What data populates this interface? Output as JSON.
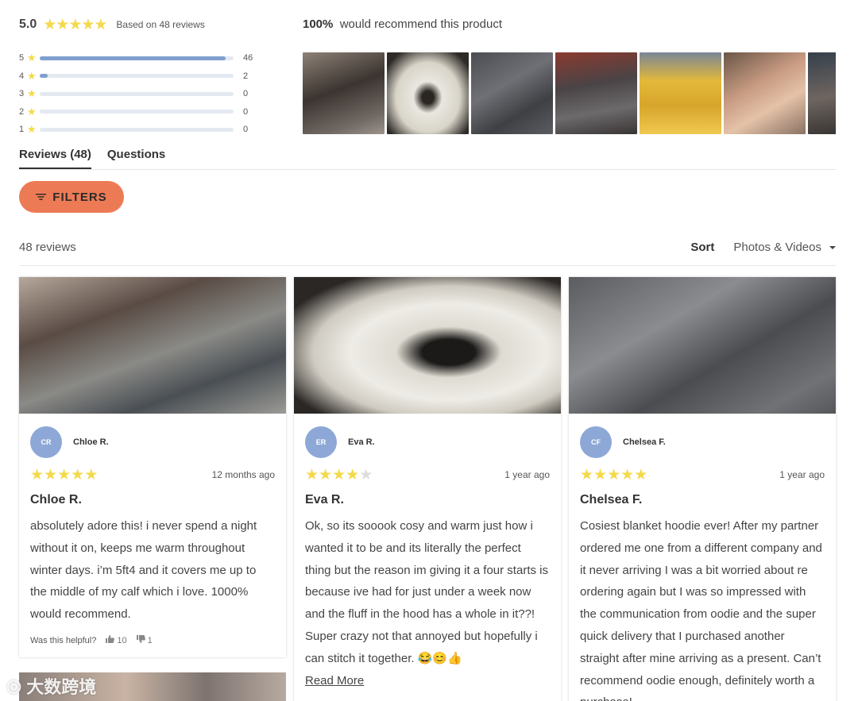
{
  "summary": {
    "average": "5.0",
    "based_on": "Based on 48 reviews",
    "histogram": [
      {
        "stars": "5",
        "count": "46",
        "fraction": 0.958
      },
      {
        "stars": "4",
        "count": "2",
        "fraction": 0.042
      },
      {
        "stars": "3",
        "count": "0",
        "fraction": 0
      },
      {
        "stars": "2",
        "count": "0",
        "fraction": 0
      },
      {
        "stars": "1",
        "count": "0",
        "fraction": 0
      }
    ]
  },
  "recommend": {
    "percent": "100%",
    "text": "would recommend this product"
  },
  "tabs": [
    {
      "label": "Reviews (48)"
    },
    {
      "label": "Questions"
    }
  ],
  "filters_label": "FILTERS",
  "reviews_count": "48 reviews",
  "sort": {
    "label": "Sort",
    "selected": "Photos & Videos"
  },
  "colors": {
    "accent": "#ec7b55",
    "star": "#f4d94a",
    "avatar": "#8da8d6",
    "bar": "#7f9fce"
  },
  "reviews": [
    {
      "initials": "CR",
      "name": "Chloe R.",
      "rating": 5,
      "when": "12 months ago",
      "title": "Chloe R.",
      "text": "absolutely adore this! i never spend a night without it on, keeps me warm throughout winter days. i’m 5ft4 and it covers me up to the middle of my calf which i love. 1000% would recommend.",
      "helpful_label": "Was this helpful?",
      "up": "10",
      "down": "1"
    },
    {
      "initials": "ER",
      "name": "Eva R.",
      "rating": 4,
      "when": "1 year ago",
      "title": "Eva R.",
      "text": "Ok, so its sooook cosy and warm just how i wanted it to be and its literally the perfect thing but the reason im giving it a four starts is because ive had for just under a week now and the fluff in the hood has a whole in it??! Super crazy not that annoyed but hopefully i can stitch it together. 😂😊👍",
      "read_more": "Read More"
    },
    {
      "initials": "CF",
      "name": "Chelsea F.",
      "rating": 5,
      "when": "1 year ago",
      "title": "Chelsea F.",
      "text": "Cosiest blanket hoodie ever! After my partner ordered me one from a different company and it never arriving I was a bit worried about re ordering again but I was so impressed with the communication from oodie and the super quick delivery that I purchased another straight after mine arriving as a present. Can’t recommend oodie enough, definitely worth a purchase!"
    }
  ],
  "watermark": "大数跨境"
}
